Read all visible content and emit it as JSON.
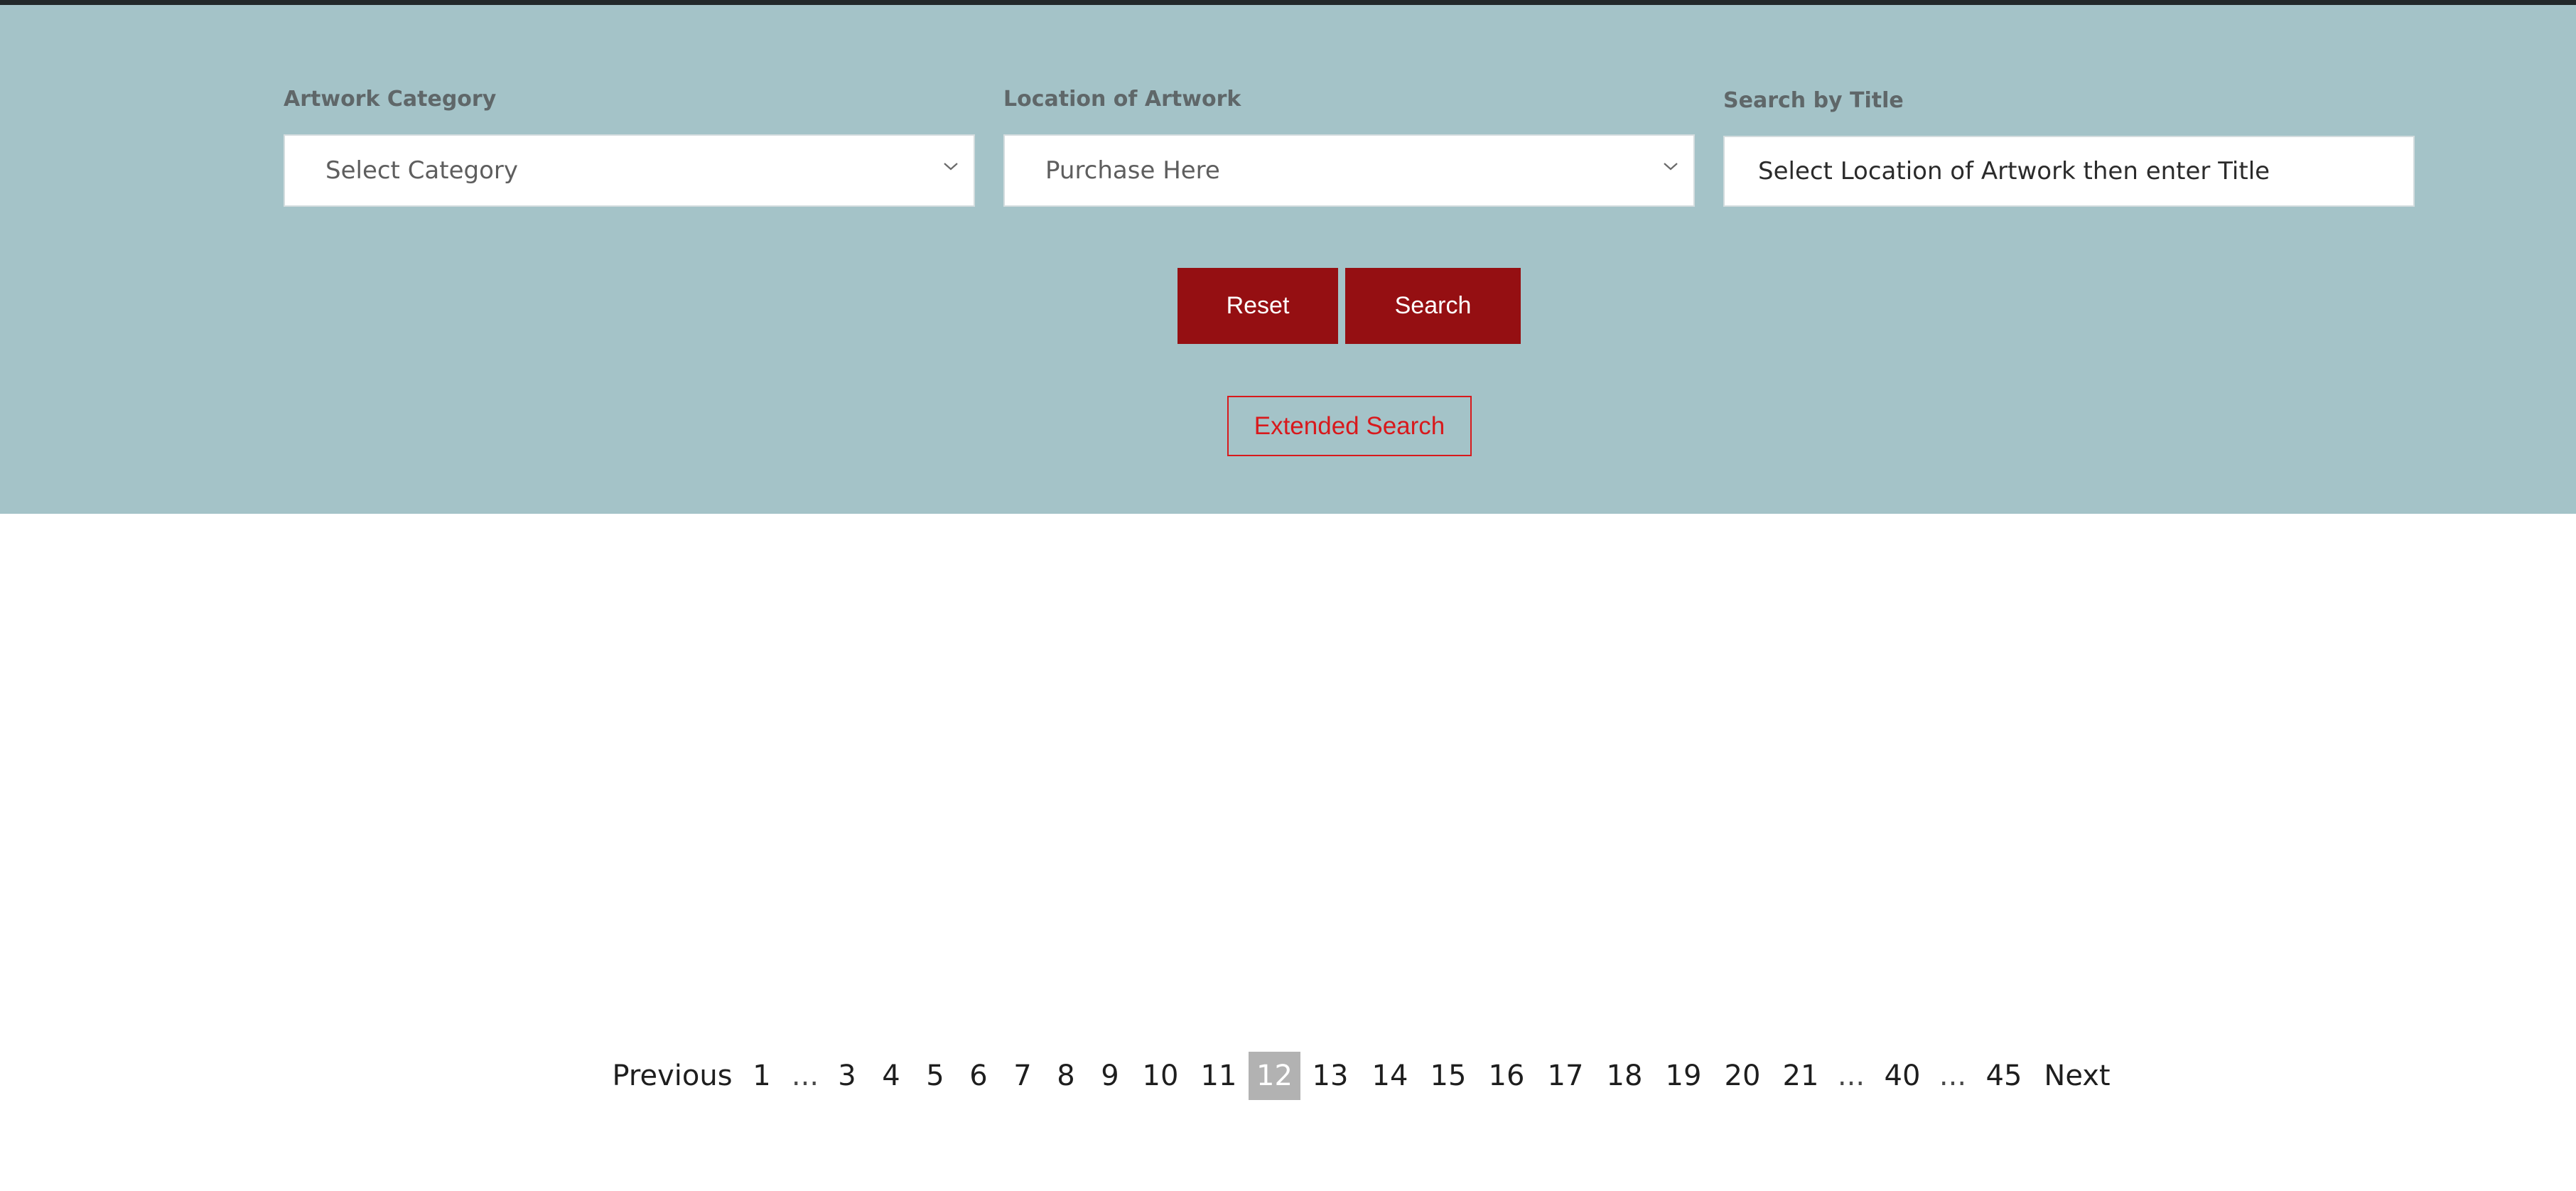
{
  "filters": {
    "category": {
      "label": "Artwork Category",
      "value": "Select Category"
    },
    "location": {
      "label": "Location of Artwork",
      "value": "Purchase Here"
    },
    "title_search": {
      "label": "Search by Title",
      "value": "Select Location of Artwork then enter Title"
    }
  },
  "actions": {
    "reset_label": "Reset",
    "search_label": "Search",
    "extended_label": "Extended Search"
  },
  "pagination": {
    "previous_label": "Previous",
    "next_label": "Next",
    "items": [
      "1",
      "...",
      "3",
      "4",
      "5",
      "6",
      "7",
      "8",
      "9",
      "10",
      "11",
      "12",
      "13",
      "14",
      "15",
      "16",
      "17",
      "18",
      "19",
      "20",
      "21",
      "...",
      "40",
      "...",
      "45"
    ],
    "current": "12"
  },
  "colors": {
    "panel_bg": "#a4c3c8",
    "primary_button": "#950f12",
    "extended_accent": "#d8191c",
    "active_page": "#b2b2b2"
  },
  "icons": {
    "dropdown": "chevron-down-icon"
  }
}
